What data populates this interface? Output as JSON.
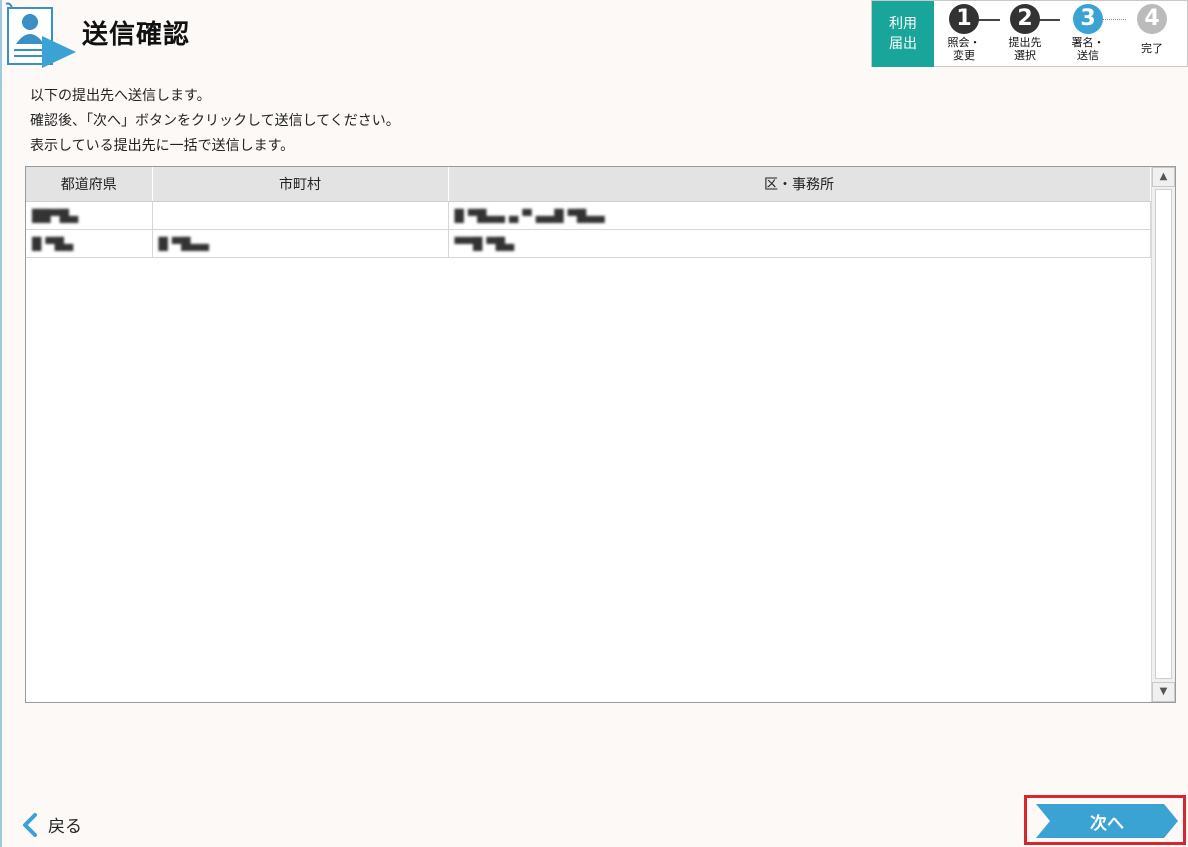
{
  "header": {
    "title": "送信確認",
    "icon": "document-person-icon"
  },
  "steps": {
    "tag_line1": "利用",
    "tag_line2": "届出",
    "items": [
      {
        "number": "1",
        "line1": "照会・",
        "line2": "変更",
        "state": "done",
        "color": "#333333"
      },
      {
        "number": "2",
        "line1": "提出先",
        "line2": "選択",
        "state": "done",
        "color": "#333333"
      },
      {
        "number": "3",
        "line1": "署名・",
        "line2": "送信",
        "state": "current",
        "color": "#3aa3d3"
      },
      {
        "number": "4",
        "line1": "完了",
        "line2": "",
        "state": "pending",
        "color": "#bbbbbb"
      }
    ]
  },
  "instructions": [
    "以下の提出先へ送信します。",
    "確認後、「次へ」ボタンをクリックして送信してください。",
    "表示している提出先に一括で送信します。"
  ],
  "table": {
    "columns": [
      "都道府県",
      "市町村",
      "区・事務所"
    ],
    "rows": [
      [
        "██▀█▄",
        "",
        "█ ▀█▄▄ ▄ ▀ ▄▄█ ▀█▄▄"
      ],
      [
        "█ ▀█▄",
        "█ ▀█▄▄",
        "▀▀█ ▀█▄"
      ]
    ]
  },
  "footer": {
    "back_label": "戻る",
    "next_label": "次へ"
  },
  "colors": {
    "accent_teal": "#1aa59a",
    "accent_blue": "#3aa3d3",
    "highlight_red": "#d8262f"
  }
}
